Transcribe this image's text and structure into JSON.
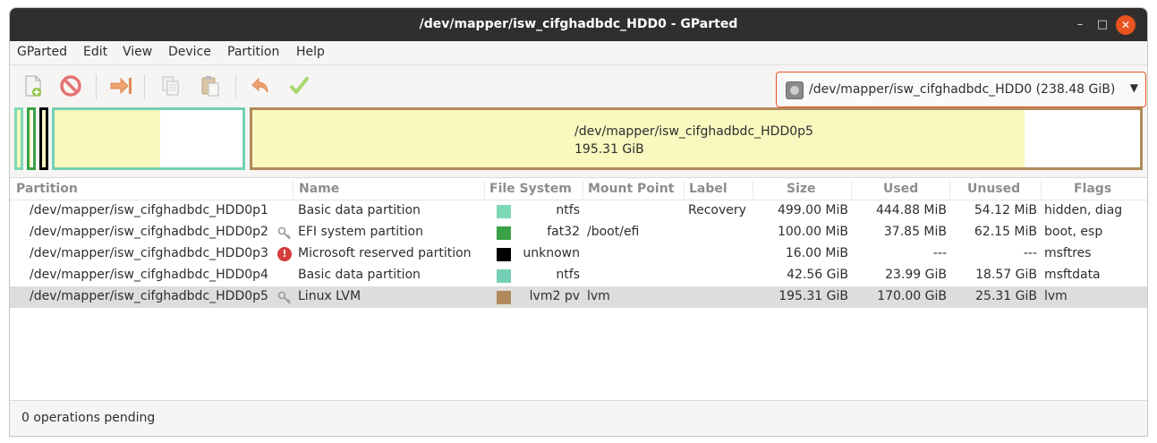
{
  "window": {
    "title": "/dev/mapper/isw_cifghadbdc_HDD0 - GParted",
    "controls": {
      "minimize": "–",
      "maximize": "□",
      "close": "✕"
    }
  },
  "menu": [
    "GParted",
    "Edit",
    "View",
    "Device",
    "Partition",
    "Help"
  ],
  "toolbar": {
    "buttons": [
      {
        "icon": "new-partition-icon"
      },
      {
        "icon": "delete-partition-icon"
      },
      {
        "icon": "resize-move-icon"
      },
      {
        "icon": "copy-icon"
      },
      {
        "icon": "paste-icon"
      },
      {
        "icon": "undo-icon"
      },
      {
        "icon": "apply-icon"
      }
    ],
    "device_selector": "/dev/mapper/isw_cifghadbdc_HDD0 (238.48 GiB)"
  },
  "disk_map": {
    "segments": [
      {
        "color": "#7fd8b4",
        "used_fraction": 0.89
      },
      {
        "color": "#3aa146",
        "used_fraction": 0.38
      },
      {
        "color": "#000000",
        "used_fraction": 1.0
      },
      {
        "color": "#74d0b4",
        "used_fraction": 0.56
      },
      {
        "color": "#b08a5c",
        "used_fraction": 0.87,
        "label_name": "/dev/mapper/isw_cifghadbdc_HDD0p5",
        "label_size": "195.31 GiB"
      }
    ]
  },
  "table": {
    "columns": [
      "Partition",
      "Name",
      "File System",
      "Mount Point",
      "Label",
      "Size",
      "Used",
      "Unused",
      "Flags"
    ],
    "rows": [
      {
        "partition": "/dev/mapper/isw_cifghadbdc_HDD0p1",
        "icon": "",
        "name": "Basic data partition",
        "fs_color": "#7fd8b4",
        "fs": "ntfs",
        "mount": "",
        "label": "Recovery",
        "size": "499.00 MiB",
        "used": "444.88 MiB",
        "unused": "54.12 MiB",
        "flags": "hidden, diag"
      },
      {
        "partition": "/dev/mapper/isw_cifghadbdc_HDD0p2",
        "icon": "key",
        "name": "EFI system partition",
        "fs_color": "#3aa146",
        "fs": "fat32",
        "mount": "/boot/efi",
        "label": "",
        "size": "100.00 MiB",
        "used": "37.85 MiB",
        "unused": "62.15 MiB",
        "flags": "boot, esp"
      },
      {
        "partition": "/dev/mapper/isw_cifghadbdc_HDD0p3",
        "icon": "warning",
        "name": "Microsoft reserved partition",
        "fs_color": "#000000",
        "fs": "unknown",
        "mount": "",
        "label": "",
        "size": "16.00 MiB",
        "used": "---",
        "unused": "---",
        "flags": "msftres"
      },
      {
        "partition": "/dev/mapper/isw_cifghadbdc_HDD0p4",
        "icon": "",
        "name": "Basic data partition",
        "fs_color": "#74d0b4",
        "fs": "ntfs",
        "mount": "",
        "label": "",
        "size": "42.56 GiB",
        "used": "23.99 GiB",
        "unused": "18.57 GiB",
        "flags": "msftdata"
      },
      {
        "partition": "/dev/mapper/isw_cifghadbdc_HDD0p5",
        "icon": "key",
        "name": "Linux LVM",
        "fs_color": "#b08a5c",
        "fs": "lvm2 pv",
        "mount": "lvm",
        "label": "",
        "size": "195.31 GiB",
        "used": "170.00 GiB",
        "unused": "25.31 GiB",
        "flags": "lvm"
      }
    ],
    "selected_row": 4
  },
  "status": "0 operations pending"
}
